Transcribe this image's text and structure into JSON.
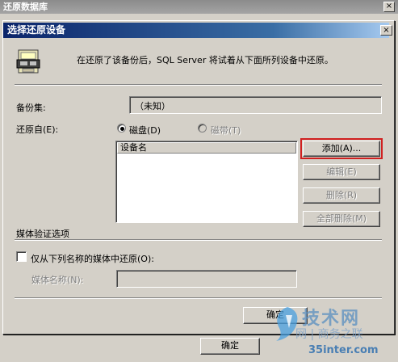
{
  "outer_window": {
    "title": "还原数据库",
    "close_glyph": "×",
    "bottom_ok_label": "确定"
  },
  "dialog": {
    "title": "选择还原设备",
    "close_glyph": "×",
    "info_text": "在还原了该备份后，SQL Server 将试着从下面所列设备中还原。",
    "backup_set_label": "备份集:",
    "backup_set_value": "（未知）",
    "restore_from_label": "还原自(E):",
    "radio_disk_label": "磁盘(D)",
    "radio_tape_label": "磁带(T)",
    "device_list_header": "设备名",
    "buttons": {
      "add": "添加(A)...",
      "edit": "编辑(E)",
      "delete": "删除(R)",
      "delete_all": "全部删除(M)",
      "ok": "确定"
    },
    "media_verify_label": "媒体验证选项",
    "restore_from_named_media_label": "仅从下列名称的媒体中还原(O):",
    "media_name_label": "媒体名称(N):",
    "media_name_value": ""
  },
  "watermark": {
    "text_main": "技术网",
    "text_sub": "网 | 商务之联",
    "url": "35inter.com"
  }
}
